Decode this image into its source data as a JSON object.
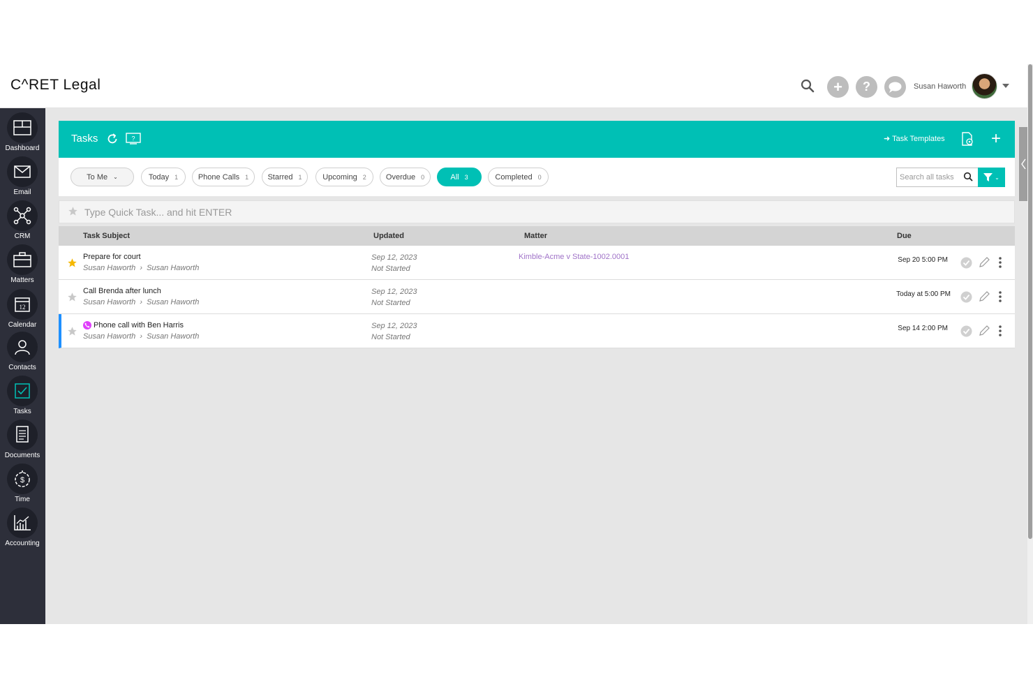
{
  "header": {
    "logo": "C^RET Legal",
    "user_name": "Susan Haworth"
  },
  "sidebar": {
    "items": [
      {
        "label": "Dashboard",
        "icon": "dashboard-icon"
      },
      {
        "label": "Email",
        "icon": "email-icon"
      },
      {
        "label": "CRM",
        "icon": "crm-icon"
      },
      {
        "label": "Matters",
        "icon": "briefcase-icon"
      },
      {
        "label": "Calendar",
        "icon": "calendar-icon",
        "day": "12"
      },
      {
        "label": "Contacts",
        "icon": "contacts-icon"
      },
      {
        "label": "Tasks",
        "icon": "tasks-icon"
      },
      {
        "label": "Documents",
        "icon": "documents-icon"
      },
      {
        "label": "Time",
        "icon": "stopwatch-icon"
      },
      {
        "label": "Accounting",
        "icon": "accounting-chart-icon"
      }
    ]
  },
  "panel": {
    "title": "Tasks",
    "templates_label": "Task Templates"
  },
  "filters": {
    "dropdown": "To Me",
    "chips": [
      {
        "label": "Today",
        "count": "1"
      },
      {
        "label": "Phone Calls",
        "count": "1"
      },
      {
        "label": "Starred",
        "count": "1"
      },
      {
        "label": "Upcoming",
        "count": "2"
      },
      {
        "label": "Overdue",
        "count": "0"
      },
      {
        "label": "All",
        "count": "3"
      },
      {
        "label": "Completed",
        "count": "0"
      }
    ],
    "search_placeholder": "Search all tasks"
  },
  "quick_task": {
    "placeholder": "Type Quick Task... and hit ENTER"
  },
  "table": {
    "columns": [
      "Task Subject",
      "Updated",
      "Matter",
      "Due"
    ],
    "rows": [
      {
        "subject": "Prepare for court",
        "from": "Susan Haworth",
        "to": "Susan Haworth",
        "updated": "Sep 12, 2023",
        "status": "Not Started",
        "matter": "Kimble-Acme v State-1002.0001",
        "due": "Sep 20 5:00 PM",
        "starred": true
      },
      {
        "subject": "Call Brenda after lunch",
        "from": "Susan Haworth",
        "to": "Susan Haworth",
        "updated": "Sep 12, 2023",
        "status": "Not Started",
        "matter": "",
        "due": "Today at 5:00 PM",
        "starred": false
      },
      {
        "subject": "Phone call with Ben Harris",
        "from": "Susan Haworth",
        "to": "Susan Haworth",
        "updated": "Sep 12, 2023",
        "status": "Not Started",
        "matter": "",
        "due": "Sep 14 2:00 PM",
        "starred": false,
        "phone_call": true
      }
    ]
  },
  "colors": {
    "accent": "#00c0b5",
    "sidebar": "#2d2f3a",
    "matter_link": "#a073c8",
    "selected_row": "#1e90ff",
    "phone_badge": "#e040fb",
    "star_active": "#f5b800"
  }
}
